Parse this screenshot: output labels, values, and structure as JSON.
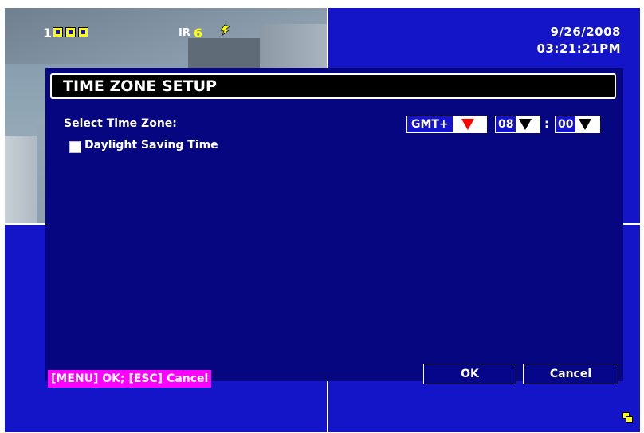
{
  "osd": {
    "channel": "1",
    "ir_label": "IR",
    "ir_number": "6",
    "date": "9/26/2008",
    "time": "03:21:21PM"
  },
  "dialog": {
    "title": "TIME ZONE SETUP",
    "select_time_zone_label": "Select Time Zone:",
    "daylight_saving_label": "Daylight Saving Time",
    "daylight_saving_checked": false,
    "gmt_value": "GMT+",
    "hour_value": "08",
    "minute_value": "00",
    "separator": ":",
    "hint": "[MENU] OK; [ESC] Cancel",
    "ok_label": "OK",
    "cancel_label": "Cancel"
  },
  "colors": {
    "background_blue": "#1414c8",
    "panel_blue": "#060680",
    "hint_magenta": "#ff00ff",
    "osd_yellow": "#ffff00",
    "arrow_red": "#ff0000"
  },
  "icons": [
    "camera-status-icon",
    "motion-icon",
    "dropdown-arrow-icon",
    "sequence-icon"
  ]
}
